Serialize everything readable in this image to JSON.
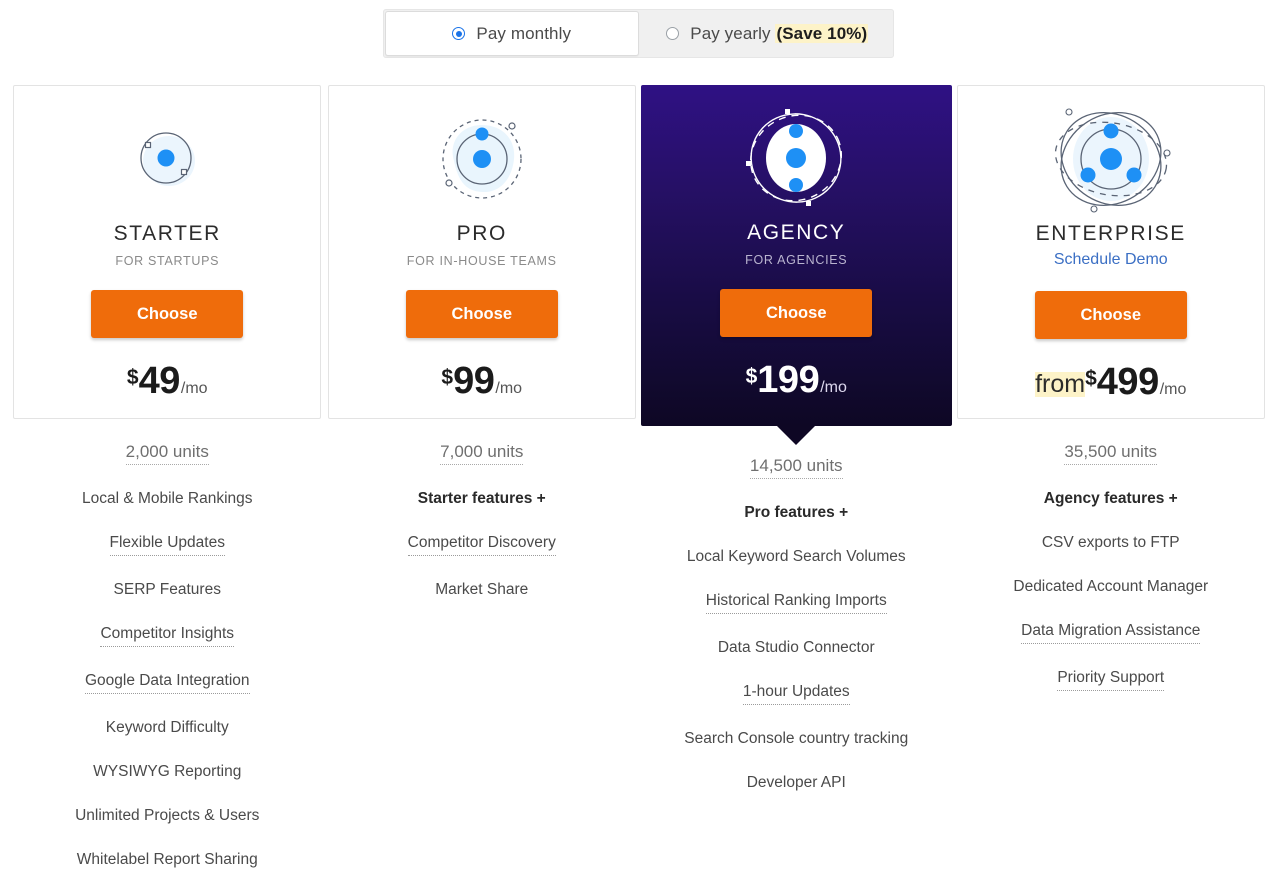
{
  "billing_toggle": {
    "options": [
      {
        "label": "Pay monthly",
        "selected": true,
        "badge": null
      },
      {
        "label": "Pay yearly",
        "selected": false,
        "badge": "(Save 10%)",
        "badge_text": "Save 10%"
      }
    ]
  },
  "colors": {
    "cta_orange": "#ef6c0b",
    "accent_blue": "#1e90f5",
    "link_blue": "#3b6fc4",
    "featured_gradient_top": "#2f1184",
    "featured_gradient_bottom": "#0e0724",
    "highlight_yellow": "#fdf3c8",
    "card_border": "#e3e3e3"
  },
  "plans": [
    {
      "id": "starter",
      "icon": "atom-1-orbit-icon",
      "name": "STARTER",
      "subtitle": "FOR STARTUPS",
      "link": null,
      "cta": "Choose",
      "price_prefix": "",
      "currency": "$",
      "amount": "49",
      "period": "/mo",
      "units": "2,000 units",
      "featured": false,
      "features": [
        {
          "text": "Local & Mobile Rankings",
          "bold": false,
          "tooltip": false
        },
        {
          "text": "Flexible Updates",
          "bold": false,
          "tooltip": true
        },
        {
          "text": "SERP Features",
          "bold": false,
          "tooltip": false
        },
        {
          "text": "Competitor Insights",
          "bold": false,
          "tooltip": true
        },
        {
          "text": "Google Data Integration",
          "bold": false,
          "tooltip": true
        },
        {
          "text": "Keyword Difficulty",
          "bold": false,
          "tooltip": false
        },
        {
          "text": "WYSIWYG Reporting",
          "bold": false,
          "tooltip": false
        },
        {
          "text": "Unlimited Projects & Users",
          "bold": false,
          "tooltip": false
        },
        {
          "text": "Whitelabel Report Sharing",
          "bold": false,
          "tooltip": false
        }
      ]
    },
    {
      "id": "pro",
      "icon": "atom-2-orbit-icon",
      "name": "PRO",
      "subtitle": "FOR IN-HOUSE TEAMS",
      "link": null,
      "cta": "Choose",
      "price_prefix": "",
      "currency": "$",
      "amount": "99",
      "period": "/mo",
      "units": "7,000 units",
      "featured": false,
      "features": [
        {
          "text": "Starter features +",
          "bold": true,
          "tooltip": false
        },
        {
          "text": "Competitor Discovery",
          "bold": false,
          "tooltip": true
        },
        {
          "text": "Market Share",
          "bold": false,
          "tooltip": false
        }
      ]
    },
    {
      "id": "agency",
      "icon": "atom-3-orbit-icon",
      "name": "AGENCY",
      "subtitle": "FOR AGENCIES",
      "link": null,
      "cta": "Choose",
      "price_prefix": "",
      "currency": "$",
      "amount": "199",
      "period": "/mo",
      "units": "14,500 units",
      "featured": true,
      "features": [
        {
          "text": "Pro features +",
          "bold": true,
          "tooltip": false
        },
        {
          "text": "Local Keyword Search Volumes",
          "bold": false,
          "tooltip": false
        },
        {
          "text": "Historical Ranking Imports",
          "bold": false,
          "tooltip": true
        },
        {
          "text": "Data Studio Connector",
          "bold": false,
          "tooltip": false
        },
        {
          "text": "1-hour Updates",
          "bold": false,
          "tooltip": true
        },
        {
          "text": "Search Console country tracking",
          "bold": false,
          "tooltip": false
        },
        {
          "text": "Developer API",
          "bold": false,
          "tooltip": false
        }
      ]
    },
    {
      "id": "enterprise",
      "icon": "atom-4-orbit-icon",
      "name": "ENTERPRISE",
      "subtitle": null,
      "link": "Schedule Demo",
      "cta": "Choose",
      "price_prefix": "from",
      "currency": "$",
      "amount": "499",
      "period": "/mo",
      "units": "35,500 units",
      "featured": false,
      "features": [
        {
          "text": "Agency features +",
          "bold": true,
          "tooltip": false
        },
        {
          "text": "CSV exports to FTP",
          "bold": false,
          "tooltip": false
        },
        {
          "text": "Dedicated Account Manager",
          "bold": false,
          "tooltip": false
        },
        {
          "text": "Data Migration Assistance",
          "bold": false,
          "tooltip": true
        },
        {
          "text": "Priority Support",
          "bold": false,
          "tooltip": true
        }
      ]
    }
  ]
}
